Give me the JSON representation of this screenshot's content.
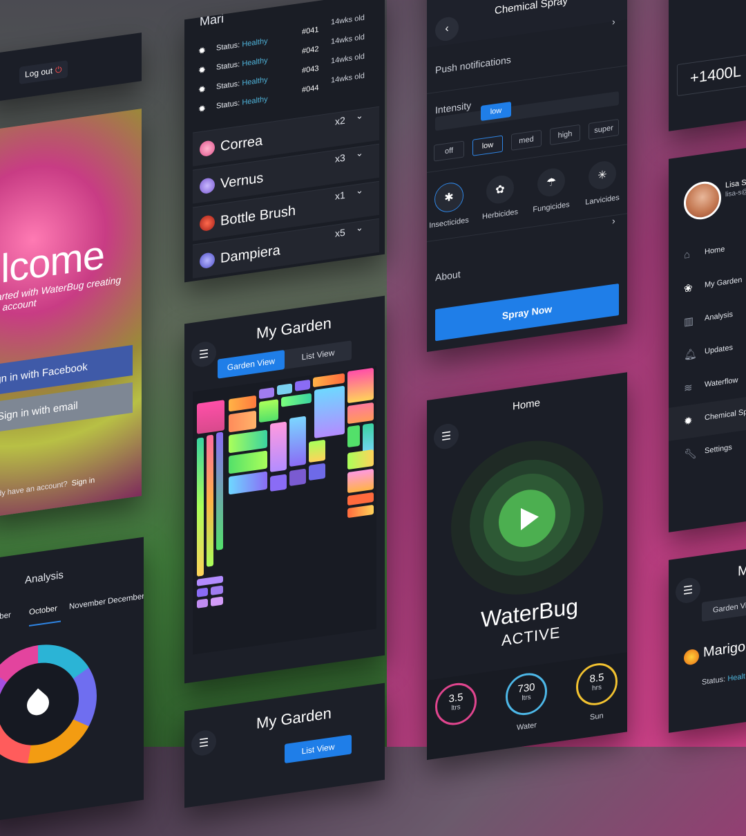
{
  "logout": {
    "label": "Log out"
  },
  "login": {
    "welcome": "elcome",
    "subtitle": "started with WaterBug creating an account",
    "facebook_btn": "ign in with Facebook",
    "email_btn": "Sign in with email",
    "have_account": "ady have an account?",
    "signin_link": "Sign in"
  },
  "analysis": {
    "title": "Analysis",
    "months": [
      "tember",
      "October",
      "November",
      "December"
    ]
  },
  "plants": {
    "header": "Mari",
    "status_rows": [
      {
        "label": "Status:",
        "value": "Healthy",
        "num": "#041",
        "age": "14wks old"
      },
      {
        "label": "Status:",
        "value": "Healthy",
        "num": "#042",
        "age": "14wks old"
      },
      {
        "label": "Status:",
        "value": "Healthy",
        "num": "#043",
        "age": "14wks old"
      },
      {
        "label": "Status:",
        "value": "Healthy",
        "num": "#044",
        "age": "14wks old"
      }
    ],
    "rows": [
      {
        "name": "Correa",
        "qty": "x2",
        "color": "#e0558e"
      },
      {
        "name": "Vernus",
        "qty": "x3",
        "color": "#7a5bd1"
      },
      {
        "name": "Bottle Brush",
        "qty": "x1",
        "color": "#d83a2e"
      },
      {
        "name": "Dampiera",
        "qty": "x5",
        "color": "#6a6ae0"
      }
    ]
  },
  "garden": {
    "title": "My Garden",
    "tab_active": "Garden View",
    "tab_inactive": "List View"
  },
  "spray": {
    "title": "Chemical Spray",
    "push": "Push notifications",
    "intensity": "Intensity",
    "current": "low",
    "levels": [
      "off",
      "low",
      "med",
      "high",
      "super"
    ],
    "chemicals": [
      "Insecticides",
      "Herbicides",
      "Fungicides",
      "Larvicides"
    ],
    "about": "About",
    "button": "Spray Now"
  },
  "home": {
    "title": "Home",
    "brand": "WaterBug",
    "state": "ACTIVE",
    "stats": [
      {
        "value": "3.5",
        "unit": "ltrs",
        "label": "",
        "color": "#e0458e"
      },
      {
        "value": "730",
        "unit": "ltrs",
        "label": "Water",
        "color": "#4db8e8"
      },
      {
        "value": "8.5",
        "unit": "hrs",
        "label": "Sun",
        "color": "#f2c230"
      }
    ]
  },
  "right": {
    "value": "+1400L",
    "user_name": "Lisa S",
    "user_email": "lisa-s@",
    "nav": [
      "Home",
      "My Garden",
      "Analysis",
      "Updates",
      "Waterflow",
      "Chemical Sp",
      "Settings"
    ],
    "garden_title": "M",
    "garden_tab": "Garden Vi",
    "plant_name": "Marigo",
    "status_label": "Status:",
    "status_value": "Healt"
  },
  "garden2": {
    "title": "My Garden",
    "tab_active": "List View"
  }
}
